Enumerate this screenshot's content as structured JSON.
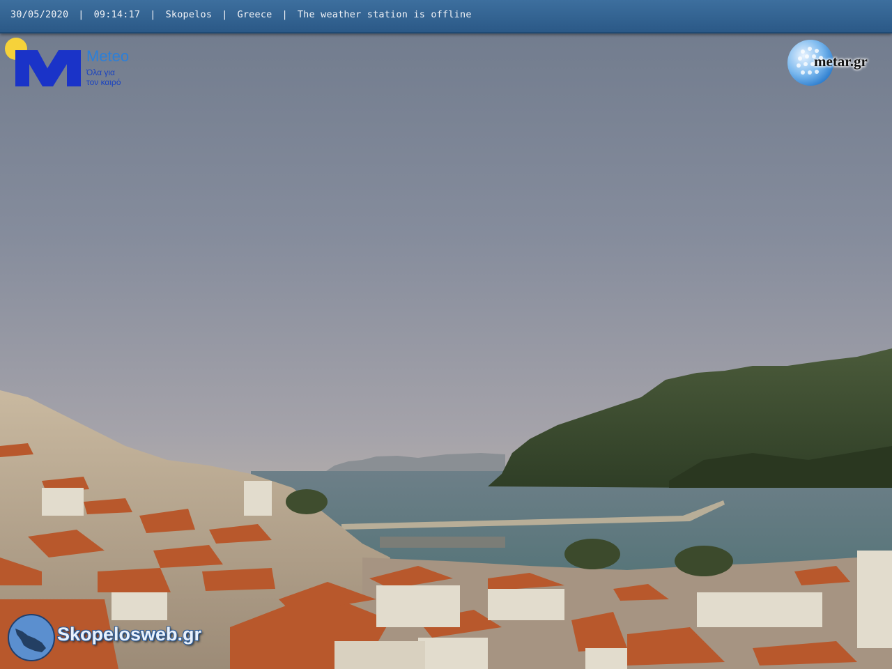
{
  "status_bar": {
    "date": "30/05/2020",
    "time": "09:14:17",
    "location": "Skopelos",
    "country": "Greece",
    "station_status": "The weather station is offline",
    "separator": "|"
  },
  "logos": {
    "meteo": {
      "name": "Meteo",
      "tagline_line1": "Όλα για",
      "tagline_line2": "τον καιρό"
    },
    "metar": {
      "name": "metar.gr"
    },
    "skopelosweb": {
      "name": "Skopelosweb.gr"
    }
  },
  "colors": {
    "bar": "#2f5f90",
    "meteo_blue": "#1a33c8",
    "meteo_sun": "#f6d23a",
    "roof": "#b8582c"
  }
}
